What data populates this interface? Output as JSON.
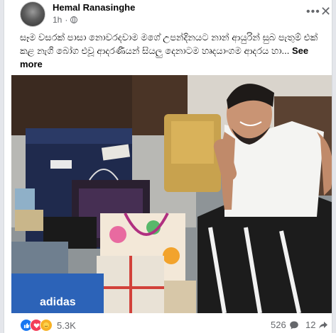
{
  "post": {
    "author": "Hemal Ranasinghe",
    "time": "1h",
    "text": "සෑම වසරක් පාසා නොවරදවාම මගේ උපන්දිනයට නාන් ආයුරින් සුබ පැතුම් එක් කළ නැගි බෝග එවූ ආදරණීයන් සියලු දෙනාටම හෘදයාංගම ආදරය හා...",
    "see_more": "See more",
    "more_icon": "•••",
    "close_icon": "✕"
  },
  "footer": {
    "reaction_count": "5.3K",
    "comment_count": "526",
    "share_count": "12"
  },
  "photo": {
    "box_brand": "adidas"
  },
  "colors": {
    "like": "#1877f2",
    "love": "#f33e58",
    "care": "#f7b125"
  }
}
